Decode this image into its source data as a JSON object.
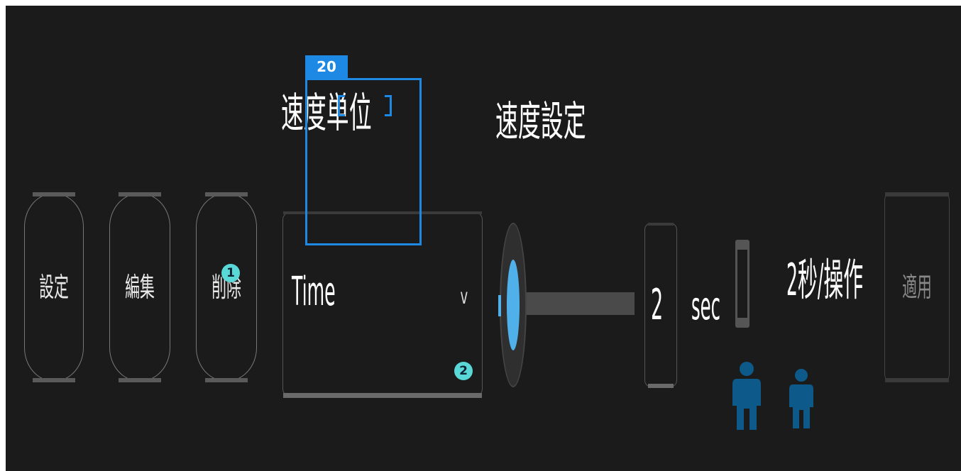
{
  "labels": {
    "speed_unit": "速度単位",
    "speed_setting": "速度設定",
    "per_operation": "2秒/操作"
  },
  "buttons": {
    "settings": "設定",
    "edit": "編集",
    "delete": "削除",
    "apply": "適用"
  },
  "select": {
    "value": "Time",
    "chevron": "v"
  },
  "number_input": {
    "value": "2",
    "unit": "sec"
  },
  "slider": {
    "level": 0
  },
  "annotation": {
    "tag": "20"
  },
  "badges": {
    "first": "1",
    "second": "2"
  },
  "colors": {
    "background": "#1b1b1b",
    "accent_blue": "#1e88e5",
    "slider_blue": "#4fb0ea",
    "badge_cyan": "#5ad8d8",
    "person_blue": "#0d5a8a"
  },
  "icons": [
    "person-icon-large",
    "person-icon-small"
  ]
}
